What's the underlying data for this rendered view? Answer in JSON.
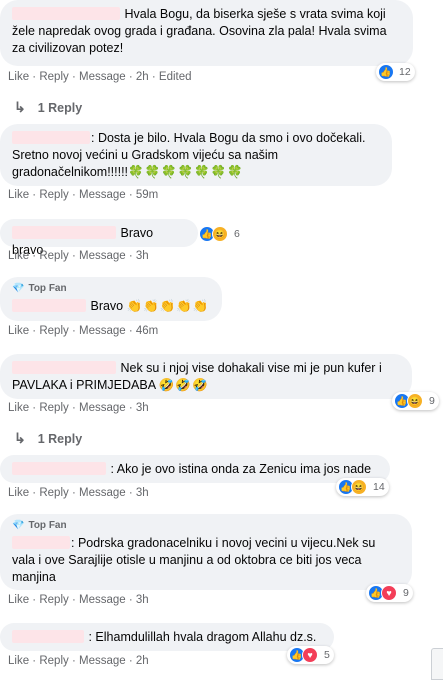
{
  "comments": [
    {
      "text": "Hvala Bogu, da biserka sješe s vrata svima koji žele napredak ovog grada i građana. Osovina zla pala! Hvala svima za civilizovan potez!",
      "like": "Like",
      "reply": "Reply",
      "message": "Message",
      "time": "2h",
      "edited": "Edited",
      "reaction_count": "12"
    },
    {
      "text": ": Dosta je bilo. Hvala Bogu da smo i ovo dočekali. Sretno novoj većini u Gradskom vijeću sa našim gradonačelnikom!!!!!!",
      "emoji": "🍀🍀🍀🍀🍀🍀🍀",
      "like": "Like",
      "reply": "Reply",
      "message": "Message",
      "time": "59m"
    },
    {
      "text": "Bravo bravo",
      "like": "Like",
      "reply": "Reply",
      "message": "Message",
      "time": "3h",
      "reaction_count": "6"
    },
    {
      "badge": "Top Fan",
      "text": "Bravo",
      "emoji": "👏👏👏👏👏",
      "like": "Like",
      "reply": "Reply",
      "message": "Message",
      "time": "46m"
    },
    {
      "text": "Nek su i njoj vise dohakali vise mi je pun kufer i PAVLAKA i PRIMJEDABA",
      "emoji": "🤣🤣🤣",
      "like": "Like",
      "reply": "Reply",
      "message": "Message",
      "time": "3h",
      "reaction_count": "9"
    },
    {
      "text": ": Ako je ovo istina onda za Zenicu ima jos nade",
      "like": "Like",
      "reply": "Reply",
      "message": "Message",
      "time": "3h",
      "reaction_count": "14"
    },
    {
      "badge": "Top Fan",
      "text": ": Podrska gradonacelniku i novoj vecini u vijecu.Nek su vala i ove Sarajlije otisle u manjinu a od oktobra ce biti jos veca manjina",
      "like": "Like",
      "reply": "Reply",
      "message": "Message",
      "time": "3h",
      "reaction_count": "9"
    },
    {
      "text": ": Elhamdulillah hvala dragom Allahu dz.s.",
      "like": "Like",
      "reply": "Reply",
      "message": "Message",
      "time": "2h",
      "reaction_count": "5"
    }
  ],
  "reply_links": [
    {
      "label": "1 Reply",
      "icon": "reply-arrow-icon"
    },
    {
      "label": "1 Reply",
      "icon": "reply-arrow-icon"
    }
  ],
  "colors": {
    "bubble": "#f0f2f5",
    "meta": "#65676b",
    "like_blue": "#1877f2",
    "name_redaction": "#fde4e8"
  }
}
